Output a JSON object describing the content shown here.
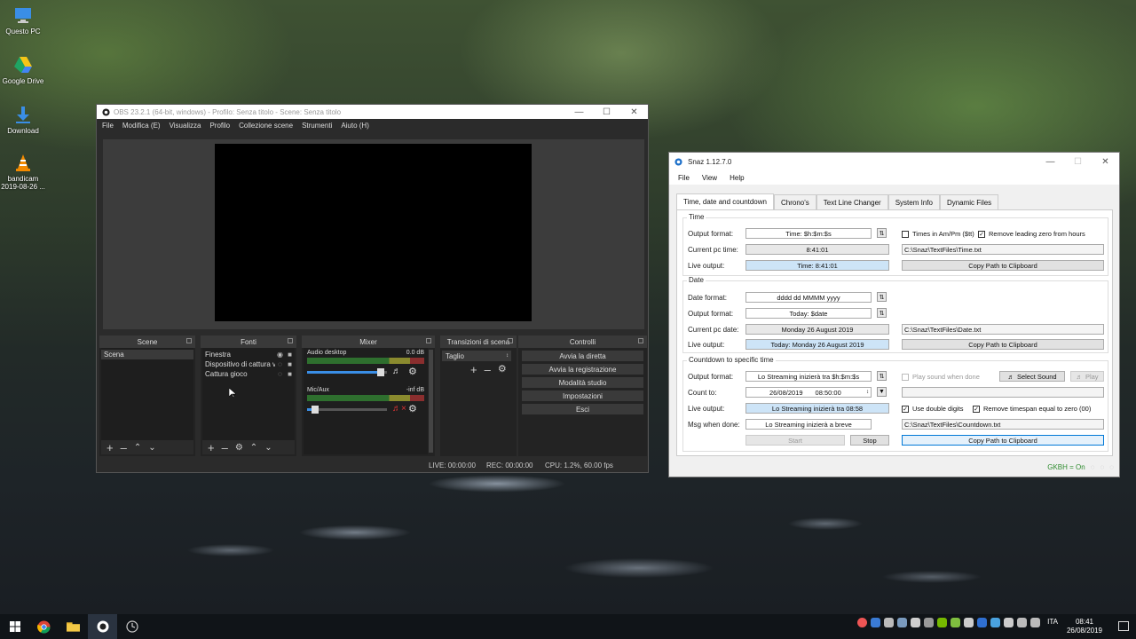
{
  "desktop": {
    "icons": [
      {
        "label": "Questo PC"
      },
      {
        "label": "Google Drive"
      },
      {
        "label": "Download"
      },
      {
        "label": "bandicam 2019-08-26 ..."
      }
    ]
  },
  "obs": {
    "title": "OBS 23.2.1 (64-bit, windows) - Profilo: Senza titolo - Scene: Senza titolo",
    "menu": [
      "File",
      "Modifica (E)",
      "Visualizza",
      "Profilo",
      "Collezione scene",
      "Strumenti",
      "Aiuto (H)"
    ],
    "docks": {
      "scenes": {
        "title": "Scene",
        "items": [
          "Scena"
        ]
      },
      "sources": {
        "title": "Fonti",
        "items": [
          "Finestra",
          "Dispositivo di cattura vid",
          "Cattura gioco"
        ]
      },
      "mixer": {
        "title": "Mixer",
        "channels": [
          {
            "name": "Audio desktop",
            "level": "0.0 dB",
            "volume_fraction": 0.92
          },
          {
            "name": "Mic/Aux",
            "level": "-inf dB",
            "volume_fraction": 0.1
          }
        ]
      },
      "transitions": {
        "title": "Transizioni di scena",
        "selected": "Taglio"
      },
      "controls": {
        "title": "Controlli",
        "buttons": [
          "Avvia la diretta",
          "Avvia la registrazione",
          "Modalità studio",
          "Impostazioni",
          "Esci"
        ]
      }
    },
    "status": {
      "live": "LIVE: 00:00:00",
      "rec": "REC: 00:00:00",
      "cpu": "CPU: 1.2%, 60.00 fps"
    }
  },
  "snaz": {
    "title": "Snaz 1.12.7.0",
    "menu": [
      "File",
      "View",
      "Help"
    ],
    "tabs": [
      "Time, date and countdown",
      "Chrono's",
      "Text Line Changer",
      "System Info",
      "Dynamic Files"
    ],
    "time": {
      "group": "Time",
      "output_format_label": "Output format:",
      "output_format": "Time: $h:$m:$s",
      "ampm_label": "Times in Am/Pm ($tt)",
      "ampm_checked": false,
      "leadzero_label": "Remove leading zero from hours",
      "leadzero_checked": true,
      "current_label": "Current pc time:",
      "current": "8:41:01",
      "path": "C:\\Snaz\\TextFiles\\Time.txt",
      "live_label": "Live output:",
      "live": "Time: 8:41:01",
      "copy": "Copy Path to Clipboard"
    },
    "date": {
      "group": "Date",
      "date_format_label": "Date format:",
      "date_format": "dddd dd MMMM yyyy",
      "output_format_label": "Output format:",
      "output_format": "Today: $date",
      "current_label": "Current pc date:",
      "current": "Monday 26 August 2019",
      "path": "C:\\Snaz\\TextFiles\\Date.txt",
      "live_label": "Live output:",
      "live": "Today: Monday 26 August 2019",
      "copy": "Copy Path to Clipboard"
    },
    "countdown": {
      "group": "Countdown to specific time",
      "output_format_label": "Output format:",
      "output_format": "Lo Streaming inizierà tra $h:$m:$s",
      "play_sound_label": "Play sound when done",
      "select_sound": "Select Sound",
      "play": "Play",
      "count_to_label": "Count to:",
      "count_to_date": "26/08/2019",
      "count_to_time": "08:50:00",
      "live_label": "Live output:",
      "live": "Lo Streaming inizierà tra 08:58",
      "double_digits_label": "Use double digits",
      "double_digits_checked": true,
      "remove_ts_label": "Remove timespan equal to zero (00)",
      "remove_ts_checked": true,
      "msg_label": "Msg when done:",
      "msg": "Lo Streaming inizierà a breve",
      "path": "C:\\Snaz\\TextFiles\\Countdown.txt",
      "start": "Start",
      "stop": "Stop",
      "copy": "Copy Path to Clipboard"
    },
    "footer": {
      "gkbh": "GKBH = On"
    }
  },
  "taskbar": {
    "time": "08:41",
    "date": "26/08/2019",
    "lang": "ITA"
  },
  "colors": {
    "obs_bg": "#2b2b2b",
    "snaz_live": "#cde4f7",
    "accent": "#0078d7",
    "gkbh": "#2e8b2e"
  }
}
